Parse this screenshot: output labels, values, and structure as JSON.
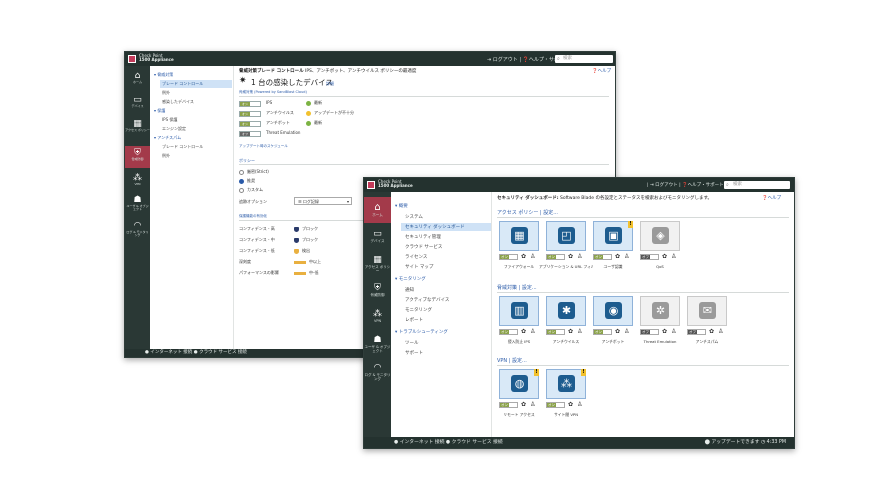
{
  "back": {
    "brand_line1": "Check Point",
    "brand_line2": "1500 Appliance",
    "top_links": "⇥ ログアウト | ❓ヘルプ・サポート",
    "search_placeholder": "検索",
    "rail": [
      {
        "icon": "home-icon",
        "label": "ホーム"
      },
      {
        "icon": "device-icon",
        "label": "デバイス"
      },
      {
        "icon": "access-policy-icon",
        "label": "アクセス ポリシー"
      },
      {
        "icon": "threat-prevention-icon",
        "label": "脅威防御"
      },
      {
        "icon": "vpn-icon",
        "label": "VPN"
      },
      {
        "icon": "users-objects-icon",
        "label": "ユーザ & オブジェクト"
      },
      {
        "icon": "logs-monitoring-icon",
        "label": "ログ & モニタリング"
      }
    ],
    "tree": {
      "s1": "▾ 脅威対策",
      "i1": "ブレード コントロール",
      "i2": "例外",
      "i3": "感染したデバイス",
      "s2": "▾ 保護",
      "i4": "IPS 保護",
      "i5": "エンジン設定",
      "s3": "▾ アンチスパム",
      "i6": "ブレード コントロール",
      "i7": "例外"
    },
    "header": "脅威対策ブレード コントロール",
    "header_rest": "IPS、アンチボット、アンチウイルス ポリシーの最適度",
    "help": "❓ヘルプ",
    "infected_title": "1 台の感染したデバイス",
    "infected_link": "詳細",
    "blades_label": "脅威対策 (Powered by SandBlast Cloud)",
    "blades": [
      {
        "name": "IPS",
        "status": "最新",
        "state": "オン",
        "status_color": "#7cb342"
      },
      {
        "name": "アンチウイルス",
        "status": "アップデートが不十分",
        "state": "オン",
        "status_color": "#f2c12e"
      },
      {
        "name": "アンチボット",
        "status": "最新",
        "state": "オン",
        "status_color": "#7cb342"
      },
      {
        "name": "Threat Emulation",
        "status": "",
        "state": "オフ",
        "status_color": ""
      }
    ],
    "update_link": "アップデート時のスケジュール",
    "policy_label": "ポリシー",
    "policy_options": [
      "厳密(Strict)",
      "推奨",
      "カスタム"
    ],
    "policy_selected": 1,
    "tracking_label": "追跡オプション",
    "tracking_value": "☰ ログ記録",
    "protection_label": "保護機能の有効化",
    "protections": [
      {
        "label": "コンフィデンス - 高",
        "value": "ブロック",
        "color": "#2a3a6a"
      },
      {
        "label": "コンフィデンス - 中",
        "value": "ブロック",
        "color": "#2a3a6a"
      },
      {
        "label": "コンフィデンス - 低",
        "value": "検出",
        "color": "#e9b040"
      },
      {
        "label": "深刻度",
        "value": "中以上",
        "color": "#e9b040"
      },
      {
        "label": "パフォーマンスの影響",
        "value": "中-低",
        "color": "#e9b040"
      }
    ],
    "bottom": "● インターネット 接続  ● クラウド サービス 接続"
  },
  "front": {
    "brand_line1": "Check Point",
    "brand_line2": "1500 Appliance",
    "top_links": "| ⇥ ログアウト | ❓ヘルプ・サポート",
    "search_placeholder": "検索",
    "rail": [
      {
        "icon": "home-icon",
        "label": "ホーム"
      },
      {
        "icon": "device-icon",
        "label": "デバイス"
      },
      {
        "icon": "access-policy-icon",
        "label": "アクセス ポリシー"
      },
      {
        "icon": "threat-prevention-icon",
        "label": "脅威防御"
      },
      {
        "icon": "vpn-icon",
        "label": "VPN"
      },
      {
        "icon": "users-objects-icon",
        "label": "ユーザ & オブジェクト"
      },
      {
        "icon": "logs-monitoring-icon",
        "label": "ログ & モニタリング"
      }
    ],
    "tree": {
      "s1": "▾ 概要",
      "i1": "システム",
      "i2": "セキュリティ ダッシュボード",
      "i3": "セキュリティ管理",
      "i4": "クラウド サービス",
      "i5": "ライセンス",
      "i6": "サイト マップ",
      "s2": "▾ モニタリング",
      "i7": "通知",
      "i8": "アクティブなデバイス",
      "i9": "モニタリング",
      "i10": "レポート",
      "s3": "▾ トラブルシューティング",
      "i11": "ツール",
      "i12": "サポート"
    },
    "header_bold": "セキュリティ ダッシュボード:",
    "header_rest": " Software Blade の各設定とステータスを検索およびモニタリングします。",
    "help": "❓ヘルプ",
    "sections": [
      {
        "title": "アクセス ポリシー | 設定...",
        "tiles": [
          {
            "label": "ファイアウォール",
            "state": "オン",
            "glyph": "▦",
            "warn": false
          },
          {
            "label": "アプリケーション & URL フィルタリング",
            "state": "オン",
            "glyph": "◰",
            "warn": false
          },
          {
            "label": "ユーザ認識",
            "state": "オン",
            "glyph": "▣",
            "warn": true
          },
          {
            "label": "QoS",
            "state": "オフ",
            "glyph": "◈",
            "warn": false
          }
        ]
      },
      {
        "title": "脅威対策 | 設定...",
        "tiles": [
          {
            "label": "侵入防止 IPS",
            "state": "オン",
            "glyph": "▥",
            "warn": false
          },
          {
            "label": "アンチウイルス",
            "state": "オン",
            "glyph": "✱",
            "warn": false
          },
          {
            "label": "アンチボット",
            "state": "オン",
            "glyph": "◉",
            "warn": false
          },
          {
            "label": "Threat Emulation",
            "state": "オフ",
            "glyph": "✲",
            "warn": false
          },
          {
            "label": "アンチスパム",
            "state": "オフ",
            "glyph": "✉",
            "warn": false
          }
        ]
      },
      {
        "title": "VPN | 設定...",
        "tiles": [
          {
            "label": "リモート アクセス",
            "state": "オン",
            "glyph": "◍",
            "warn": true
          },
          {
            "label": "サイト間 VPN",
            "state": "オン",
            "glyph": "⁂",
            "warn": true
          }
        ]
      }
    ],
    "bottom_left": "● インターネット 接続  ● クラウド サービス 接続",
    "bottom_right": "⬤ アップデートできます  ◷ 4:33 PM"
  }
}
